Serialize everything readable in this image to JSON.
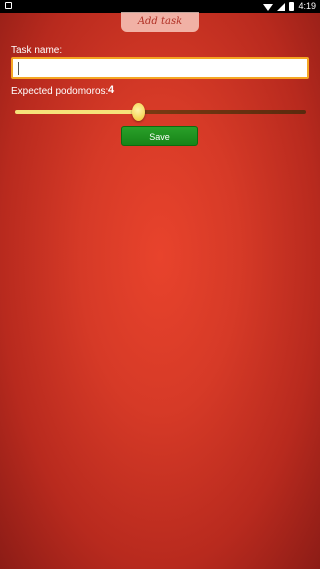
{
  "status_bar": {
    "time": "4:19"
  },
  "header": {
    "tab_label": "Add task"
  },
  "form": {
    "task_name_label": "Task name:",
    "task_name_value": "",
    "expected_label": "Expected podomoros:",
    "expected_value": "4",
    "slider_fraction": 0.43,
    "save_label": "Save"
  },
  "colors": {
    "background": "#d63a27",
    "input_border": "#f5a623",
    "save_button": "#1f931f",
    "slider_fill": "#f6e27a",
    "slider_track": "#6b3310"
  },
  "icons": [
    "notification-icon",
    "wifi-icon",
    "signal-icon",
    "battery-icon"
  ]
}
